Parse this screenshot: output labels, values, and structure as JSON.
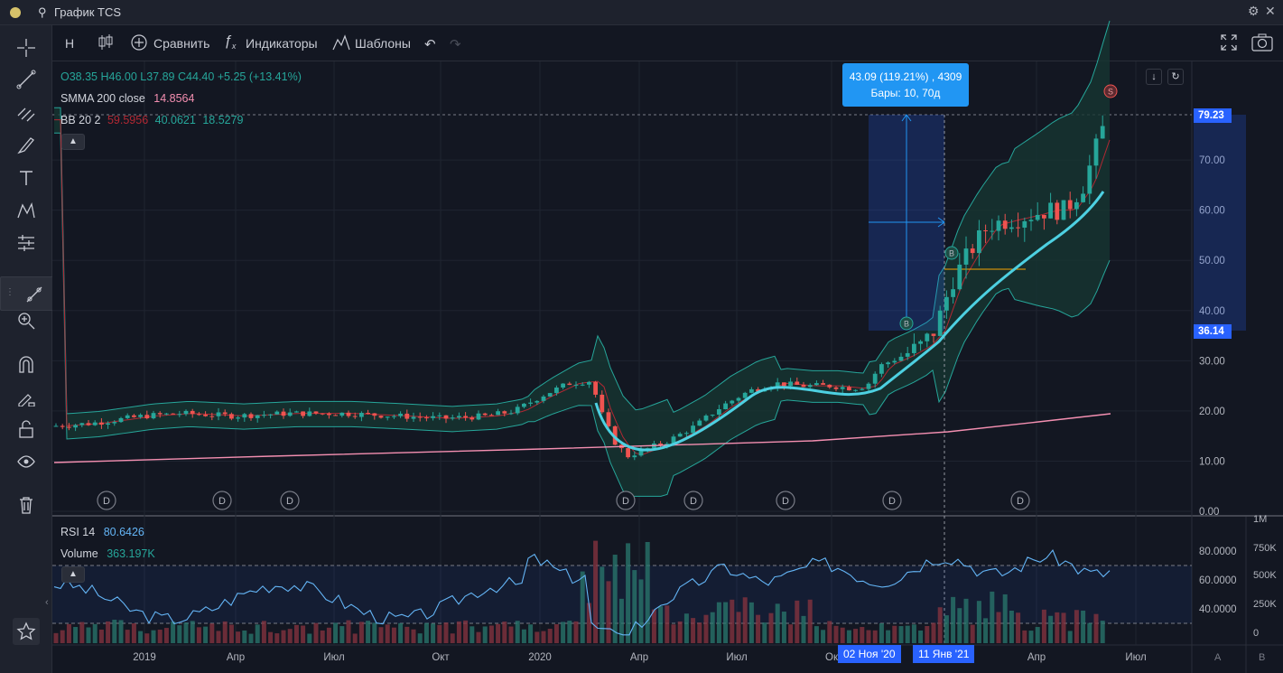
{
  "window": {
    "title": "График TCS"
  },
  "toolbar": {
    "interval": "Н",
    "compare": "Сравнить",
    "indicators": "Индикаторы",
    "templates": "Шаблоны"
  },
  "legend": {
    "ohlc": "O38.35 H46.00 L37.89 C44.40 +5.25 (+13.41%)",
    "smma_label": "SMMA 200 close",
    "smma_value": "14.8564",
    "bb_label": "BB 20 2",
    "bb_upper": "59.5956",
    "bb_mid": "40.0621",
    "bb_lower": "18.5279",
    "rsi_label": "RSI 14",
    "rsi_value": "80.6426",
    "vol_label": "Volume",
    "vol_value": "363.197K"
  },
  "measure": {
    "line1": "43.09 (119.21%) , 4309",
    "line2": "Бары: 10, 70д"
  },
  "price_axis": {
    "ticks": [
      "70.00",
      "60.00",
      "50.00",
      "40.00",
      "30.00",
      "20.00",
      "10.00",
      "0.00"
    ],
    "tag_high": "79.23",
    "tag_low": "36.14"
  },
  "rsi_axis": {
    "ticks": [
      "80.0000",
      "60.0000",
      "40.0000"
    ]
  },
  "volume_axis": {
    "ticks": [
      "1M",
      "750K",
      "500K",
      "250K",
      "0"
    ]
  },
  "time_axis": {
    "labels": [
      "2019",
      "Апр",
      "Июл",
      "Окт",
      "2020",
      "Апр",
      "Июл",
      "Ок",
      "Апр",
      "Июл"
    ],
    "tag_start": "02 Ноя '20",
    "tag_end": "11 Янв '21"
  },
  "markers": {
    "dividend": "D",
    "buy": "B",
    "sell": "S"
  },
  "corner": {
    "a": "A",
    "b": "B"
  },
  "colors": {
    "up": "#26a69a",
    "down": "#ef5350",
    "accent": "#2962ff",
    "bb_fill": "#1a3a36",
    "smma": "#f48fb1",
    "trend": "#4dd0e1"
  }
}
